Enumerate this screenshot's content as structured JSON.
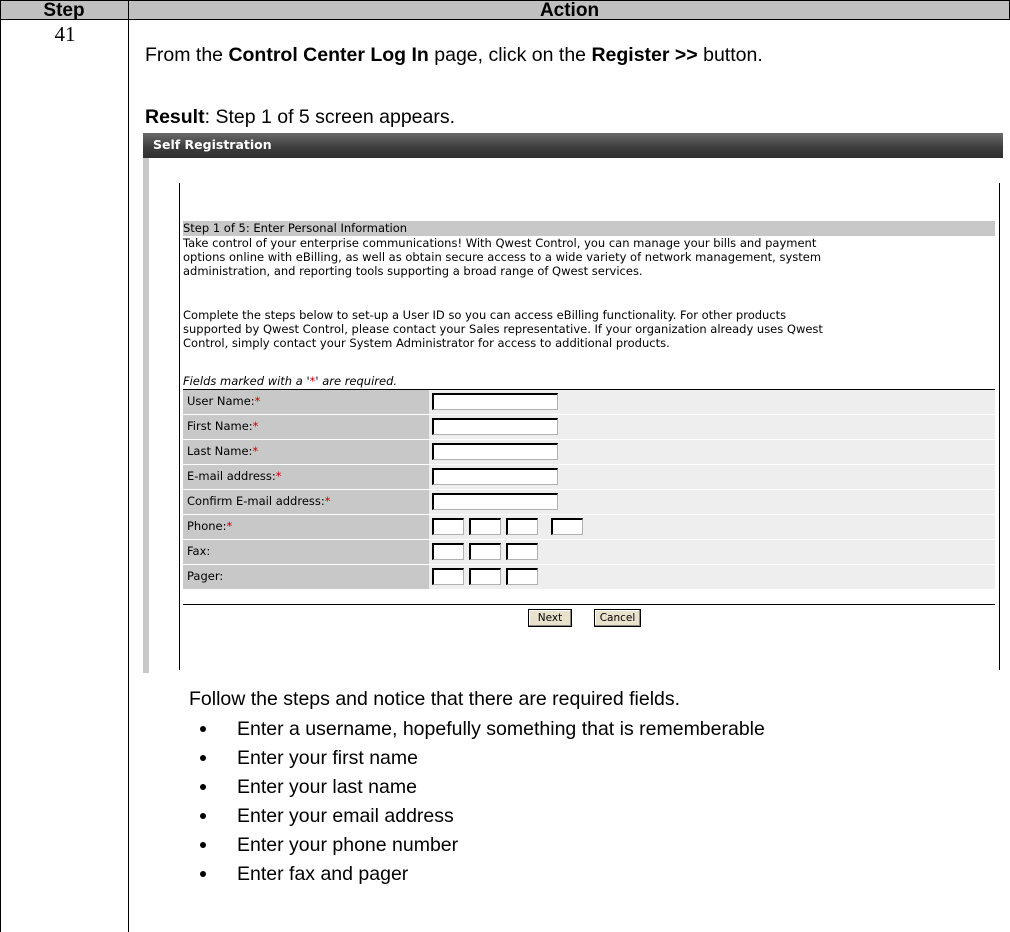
{
  "table": {
    "header_step": "Step",
    "header_action": "Action",
    "step_number": "41"
  },
  "instruction": {
    "prefix": "From the ",
    "page_name": "Control Center Log In",
    "middle": " page, click on the ",
    "button_name": "Register >>",
    "suffix": " button."
  },
  "result": {
    "label": "Result",
    "text": ":  Step 1 of 5 screen appears."
  },
  "screenshot": {
    "title": "Self Registration",
    "step_heading": "Step 1 of 5: Enter Personal Information",
    "intro_lines": [
      "Take control of your enterprise communications! With Qwest Control, you can manage your bills and payment",
      "options online with eBilling, as well as obtain secure access to a wide variety of network management, system",
      "administration, and reporting tools supporting a broad range of Qwest services."
    ],
    "intro2_lines": [
      "Complete the steps below to set-up a User ID so you can access eBilling functionality. For other products",
      "supported by Qwest Control, please contact your Sales representative. If your organization already uses Qwest",
      "Control, simply contact your System Administrator for access to additional products."
    ],
    "required_note_prefix": "Fields marked with a '",
    "required_note_star": "*",
    "required_note_suffix": "' are required.",
    "fields": [
      {
        "label": "User Name:",
        "required": "*"
      },
      {
        "label": "First Name:",
        "required": "*"
      },
      {
        "label": "Last Name:",
        "required": "*"
      },
      {
        "label": "E-mail address:",
        "required": "*"
      },
      {
        "label": "Confirm E-mail address:",
        "required": "*"
      },
      {
        "label": "Phone:",
        "required": "*"
      },
      {
        "label": "Fax:",
        "required": ""
      },
      {
        "label": "Pager:",
        "required": ""
      }
    ],
    "next_button": "Next",
    "cancel_button": "Cancel"
  },
  "followup": {
    "intro": "Follow the steps and notice that there are required fields.",
    "bullets": [
      "Enter a username, hopefully something that is rememberable",
      "Enter your first name",
      "Enter your last name",
      "Enter your email address",
      "Enter your phone number",
      "Enter fax and pager"
    ]
  }
}
